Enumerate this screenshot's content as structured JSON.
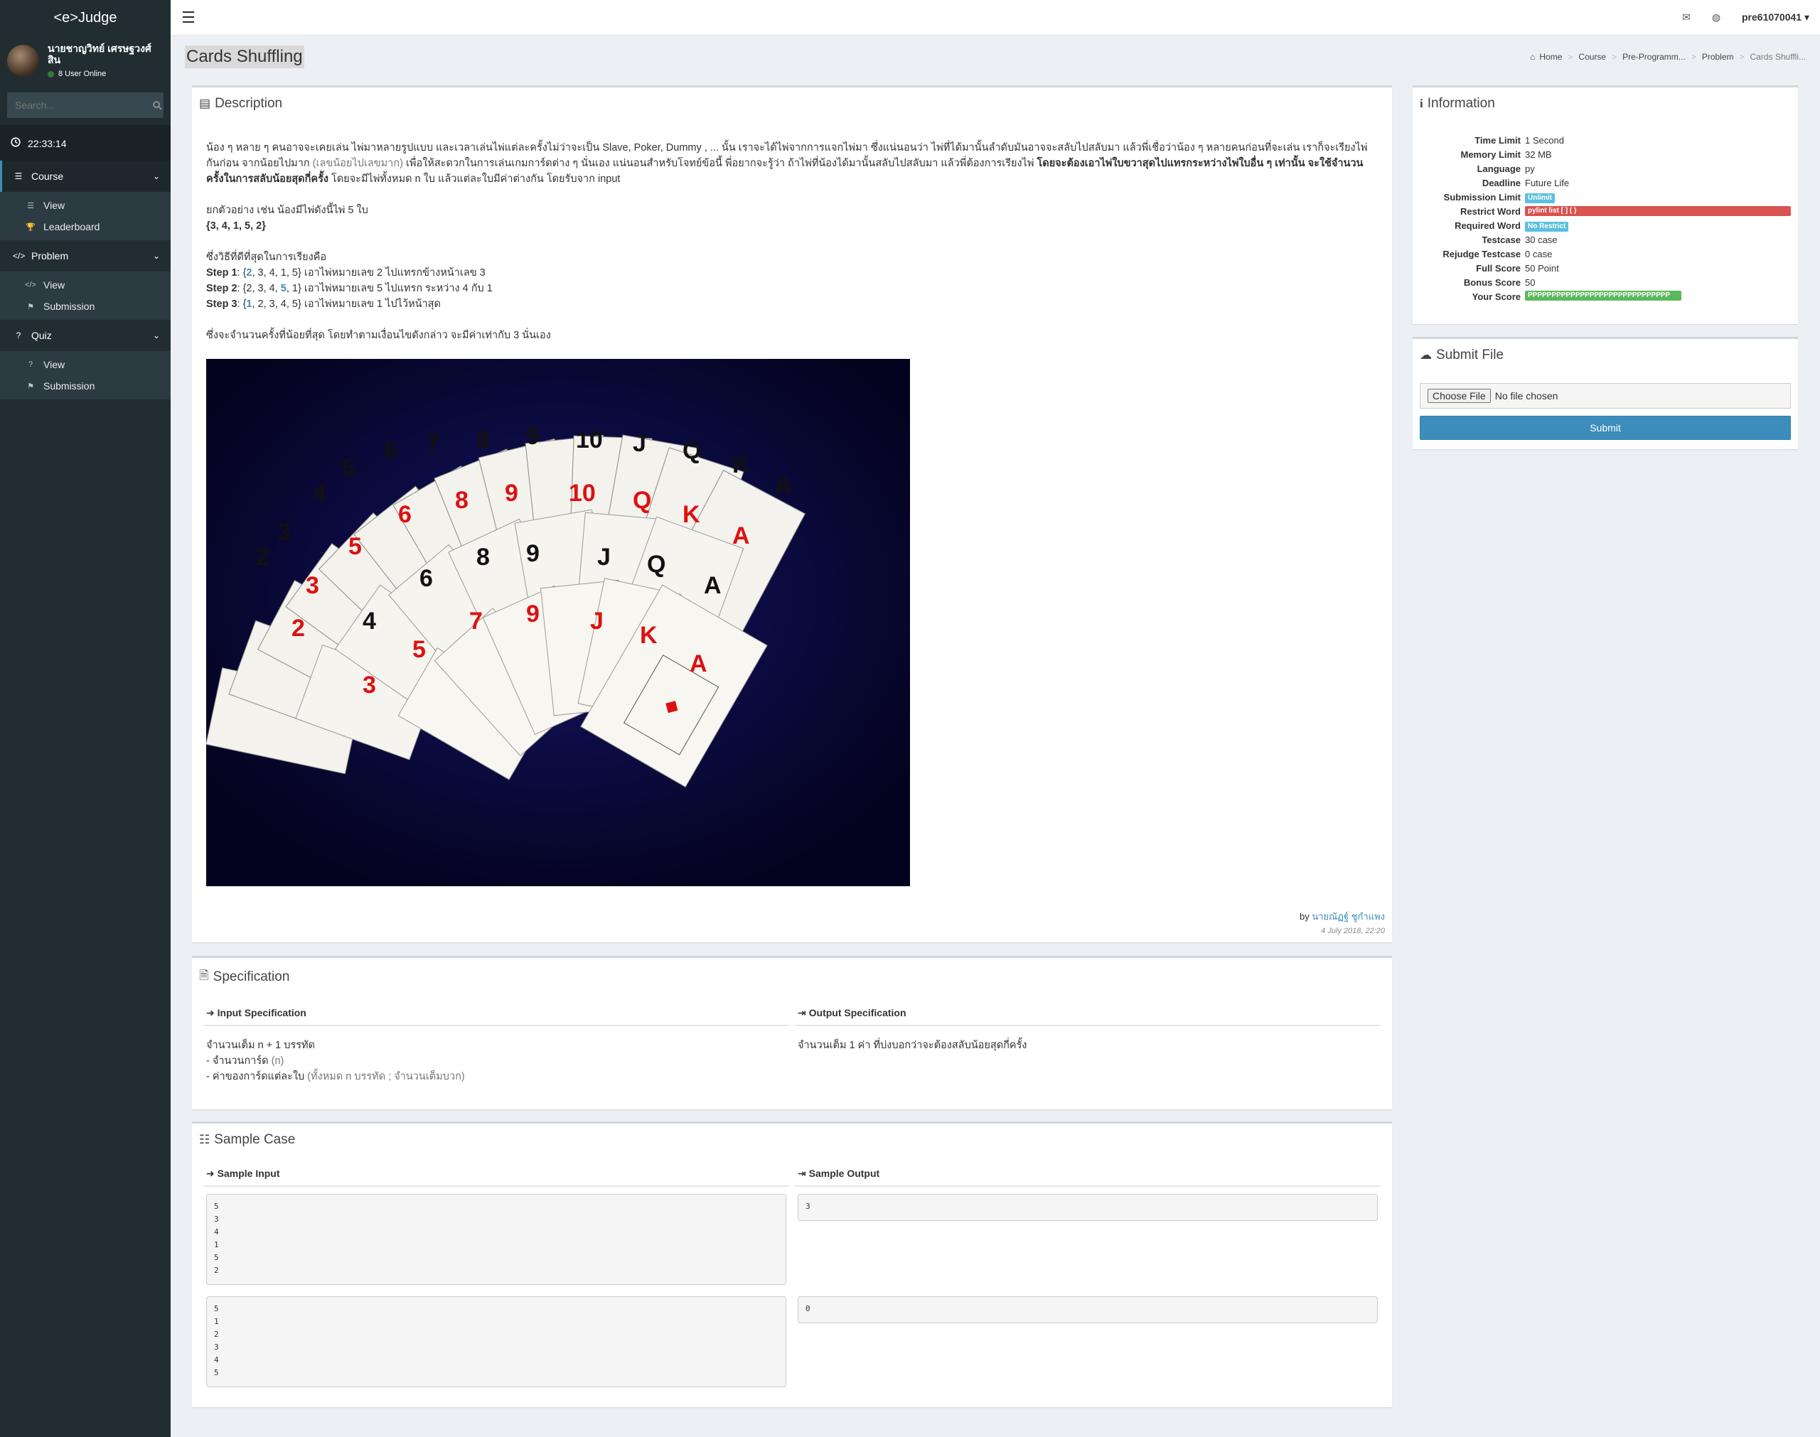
{
  "app": {
    "logo": "<e>Judge"
  },
  "user": {
    "name": "นายชาญวิทย์ เศรษฐวงศ์สิน",
    "online": "8 User Online"
  },
  "search": {
    "placeholder": "Search..."
  },
  "clock": {
    "time": "22:33:14"
  },
  "menu": {
    "course": {
      "label": "Course",
      "items": [
        "View",
        "Leaderboard"
      ]
    },
    "problem": {
      "label": "Problem",
      "items": [
        "View",
        "Submission"
      ]
    },
    "quiz": {
      "label": "Quiz",
      "items": [
        "View",
        "Submission"
      ]
    }
  },
  "topbar": {
    "username": "pre61070041"
  },
  "page": {
    "title": "Cards Shuffling"
  },
  "breadcrumb": [
    "Home",
    "Course",
    "Pre-Programm...",
    "Problem",
    "Cards Shuffli..."
  ],
  "description": {
    "title": "Description",
    "p1a": "น้อง ๆ หลาย ๆ คนอาจจะเคยเล่น ไพ่มาหลายรูปแบบ และเวลาเล่นไพ่แต่ละครั้งไม่ว่าจะเป็น Slave, Poker, Dummy , ... นั้น เราจะได้ไพ่จากการแจกไพ่มา ซึ่งแน่นอนว่า ไพ่ที่ได้มานั้นลำดับมันอาจจะสลับไปสลับมา แล้วพี่เชื่อว่าน้อง ๆ หลายคนก่อนที่จะเล่น เราก็จะเรียงไพ่กันก่อน จากน้อยไปมาก ",
    "p1b": "(เลขน้อยไปเลขมาก)",
    "p1c": " เพื่อให้สะดวกในการเล่นเกมการ์ดต่าง ๆ นั่นเอง แน่นอนสำหรับโจทย์ข้อนี้ พี่อยากจะรู้ว่า ถ้าไพ่ที่น้องได้มานั้นสลับไปสลับมา แล้วพี่ต้องการเรียงไพ่ ",
    "p1d": "โดยจะต้องเอาไพ่ใบขวาสุดไปแทรกระหว่างไพ่ใบอื่น ๆ เท่านั้น จะใช้จำนวนครั้งในการสลับน้อยสุดกี่ครั้ง",
    "p1e": " โดยจะมีไพ่ทั้งหมด n ใบ แล้วแต่ละใบมีค่าต่างกัน โดยรับจาก input",
    "ex_line": "ยกตัวอย่าง เช่น น้องมีไพ่ดังนี้ไพ่ 5 ใบ",
    "ex_set": "{3, 4, 1, 5, 2}",
    "best_line": "ซึ่งวิธีที่ดีที่สุดในการเรียงคือ",
    "steps": [
      {
        "label": "Step 1",
        "pre": ": {",
        "hl": "2",
        "post": ", 3, 4, 1, 5} เอาไพ่หมายเลข 2 ไปแทรกข้างหน้าเลข 3"
      },
      {
        "label": "Step 2",
        "pre": ": {2, 3, 4, ",
        "hl": "5",
        "post": ", 1} เอาไพ่หมายเลข 5 ไปแทรก ระหว่าง 4 กับ 1"
      },
      {
        "label": "Step 3",
        "pre": ": {",
        "hl": "1",
        "post": ", 2, 3, 4, 5} เอาไพ่หมายเลข 1 ไปไว้หน้าสุด"
      }
    ],
    "summary": "ซึ่งจะจำนวนครั้งที่น้อยที่สุด โดยทำตามเงื่อนไขดังกล่าว จะมีค่าเท่ากับ 3 นั่นเอง",
    "by": "by",
    "author": "นายณัฏฐ์ ชูกำแพง",
    "date": "4 July 2018, 22:20"
  },
  "specification": {
    "title": "Specification",
    "input_head": "Input Specification",
    "output_head": "Output Specification",
    "input_l1": "จำนวนเต็ม n + 1 บรรทัด",
    "input_l2a": "- จำนวนการ์ด ",
    "input_l2b": "(n)",
    "input_l3a": "- ค่าของการ์ดแต่ละใบ ",
    "input_l3b": "(ทั้งหมด n บรรทัด ; จำนวนเต็มบวก)",
    "output": "จำนวนเต็ม 1 ค่า ที่บ่งบอกว่าจะต้องสลับน้อยสุดกี่ครั้ง"
  },
  "samples": {
    "title": "Sample Case",
    "input_head": "Sample Input",
    "output_head": "Sample Output",
    "cases": [
      {
        "input": "5\n3\n4\n1\n5\n2",
        "output": "3"
      },
      {
        "input": "5\n1\n2\n3\n4\n5",
        "output": "0"
      }
    ]
  },
  "information": {
    "title": "Information",
    "rows": [
      {
        "k": "Time Limit",
        "v": "1 Second"
      },
      {
        "k": "Memory Limit",
        "v": "32 MB"
      },
      {
        "k": "Language",
        "v": "py"
      },
      {
        "k": "Deadline",
        "v": "Future Life"
      },
      {
        "k": "Submission Limit",
        "badge": "Unlimit"
      },
      {
        "k": "Restrict Word",
        "badge": "pylint list [ ] ( )"
      },
      {
        "k": "Required Word",
        "badge": "No Restrict"
      },
      {
        "k": "Testcase",
        "v": "30 case"
      },
      {
        "k": "Rejudge Testcase",
        "v": "0 case"
      },
      {
        "k": "Full Score",
        "v": "50 Point"
      },
      {
        "k": "Bonus Score",
        "v": "50"
      },
      {
        "k": "Your Score",
        "badge": "PPPPPPPPPPPPPPPPPPPPPPPPPPPPPP"
      }
    ]
  },
  "submit": {
    "title": "Submit File",
    "choose": "Choose File",
    "nofile": "No file chosen",
    "button": "Submit"
  },
  "colors": {
    "sidebar": "#222d32",
    "accent": "#3c8dbc",
    "danger": "#d9534f",
    "success": "#5cb85c",
    "info": "#5bc0de"
  }
}
